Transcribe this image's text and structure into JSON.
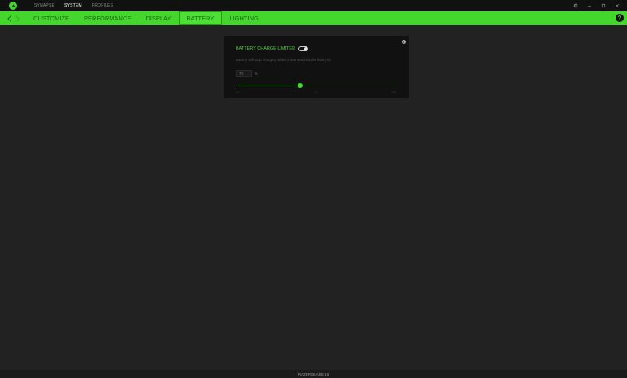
{
  "titlebar": {
    "tabs": [
      {
        "label": "SYNAPSE",
        "active": false
      },
      {
        "label": "SYSTEM",
        "active": true
      },
      {
        "label": "PROFILES",
        "active": false
      }
    ]
  },
  "navbar": {
    "tabs": [
      {
        "label": "CUSTOMIZE",
        "active": false
      },
      {
        "label": "PERFORMANCE",
        "active": false
      },
      {
        "label": "DISPLAY",
        "active": false
      },
      {
        "label": "BATTERY",
        "active": true
      },
      {
        "label": "LIGHTING",
        "active": false
      }
    ],
    "help_label": "?"
  },
  "battery": {
    "limiter_label": "BATTERY CHARGE LIMITER",
    "limiter_enabled": true,
    "description": "Battery will stop charging when it has reached the limit (%).",
    "value": "70",
    "unit": "%",
    "slider": {
      "min": 50,
      "max": 100,
      "value": 70
    },
    "slider_labels": [
      "50",
      "70",
      "100"
    ]
  },
  "footer": {
    "device_name": "RAZER BLADE 16"
  },
  "colors": {
    "accent": "#44d62c",
    "background": "#222222",
    "card": "#111111"
  }
}
